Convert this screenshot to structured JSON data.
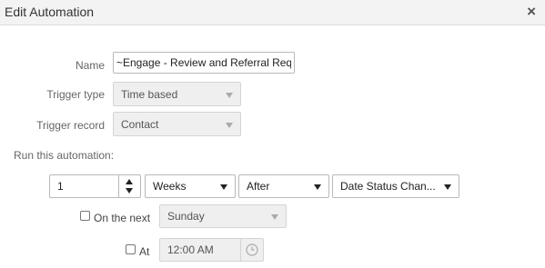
{
  "dialog": {
    "title": "Edit Automation",
    "close_symbol": "×"
  },
  "form": {
    "name_label": "Name",
    "name_value": "~Engage - Review and Referral Requ",
    "trigger_type_label": "Trigger type",
    "trigger_type_value": "Time based",
    "trigger_record_label": "Trigger record",
    "trigger_record_value": "Contact",
    "run_label": "Run this automation:",
    "run": {
      "quantity": "1",
      "unit": "Weeks",
      "relation": "After",
      "reference": "Date Status Chan..."
    },
    "on_next_label": "On the next",
    "on_next_value": "Sunday",
    "at_label": "At",
    "at_value": "12:00 AM"
  },
  "icons": {
    "close": "close-icon",
    "spin_up": "chevron-up-icon",
    "spin_down": "chevron-down-icon",
    "clock": "clock-icon"
  }
}
